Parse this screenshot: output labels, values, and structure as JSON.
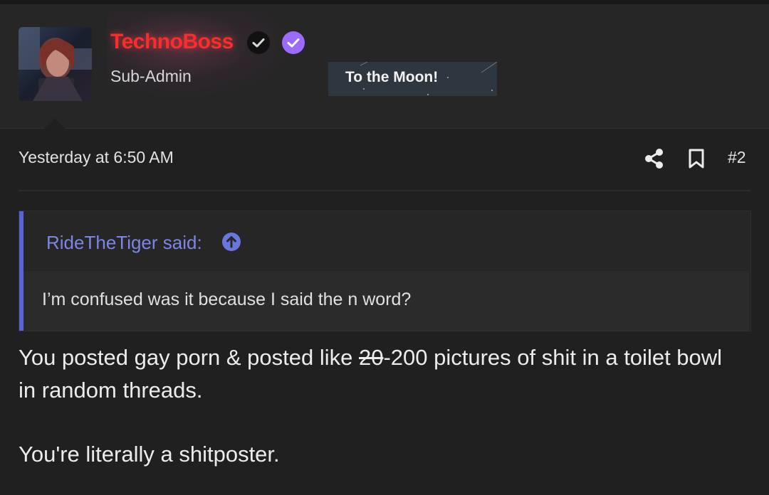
{
  "colors": {
    "page_bg": "#202020",
    "username": "#ff2a2a",
    "quote_accent": "#5865d8",
    "quote_author": "#7b86e6",
    "verified_badge": "#9b6bff"
  },
  "user": {
    "name": "TechnoBoss",
    "title": "Sub-Admin",
    "banner": "To the Moon!",
    "badges": [
      "dark-check-badge-icon",
      "verified-badge-icon"
    ]
  },
  "post": {
    "date": "Yesterday at 6:50 AM",
    "number": "#2",
    "actions": [
      "share-icon",
      "bookmark-icon"
    ]
  },
  "quote": {
    "author_label": "RideTheTiger said:",
    "text": "I’m confused was it because I said the n word?"
  },
  "body": {
    "line1_before": "You posted gay porn & posted like ",
    "line1_struck": "20",
    "line1_after": "-200 pictures of shit in a toilet bowl in random threads.",
    "line2": "You're literally a shitposter."
  }
}
